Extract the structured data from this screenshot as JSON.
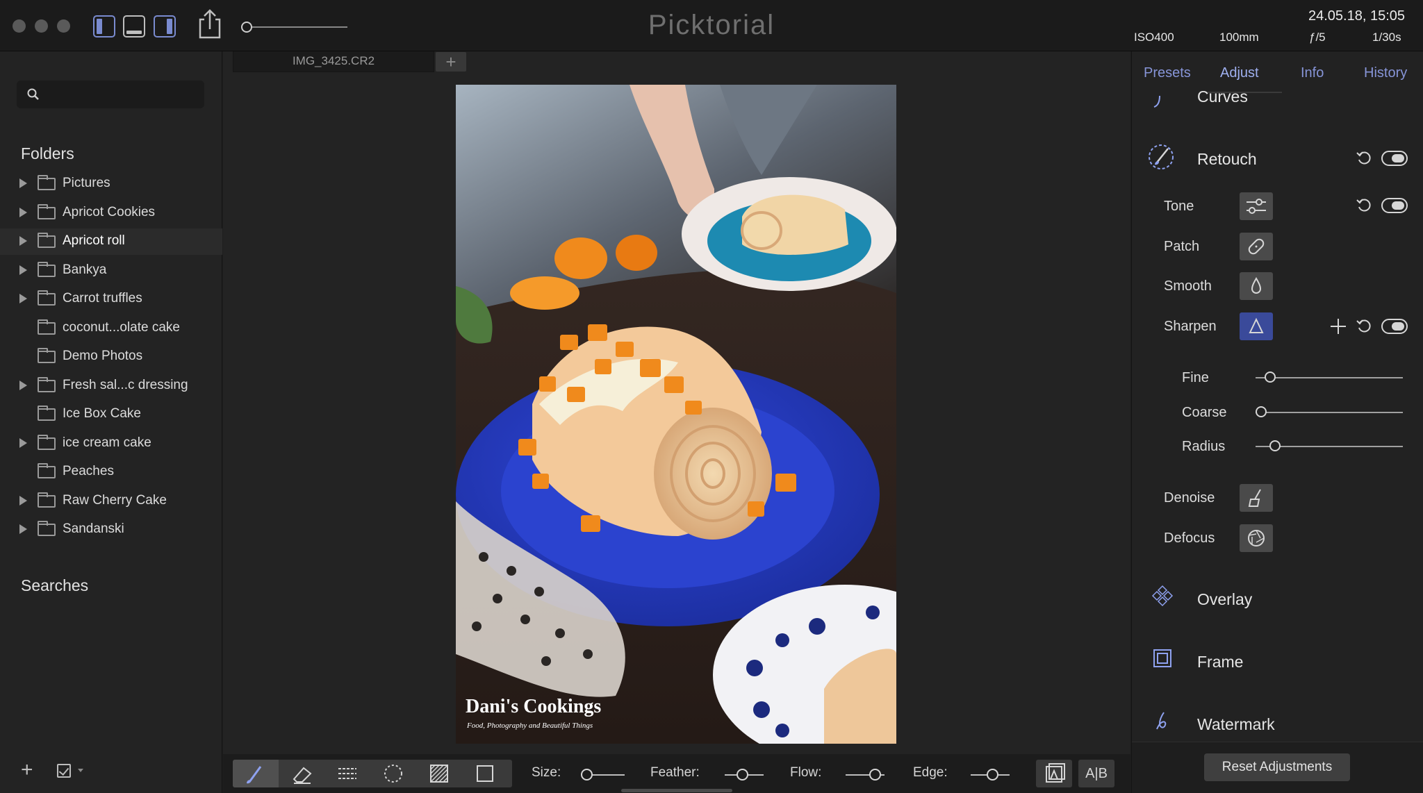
{
  "app": {
    "title": "Picktorial"
  },
  "exif": {
    "iso": "ISO400",
    "focal": "100mm",
    "aperture": "ƒ/5",
    "shutter": "1/30s",
    "datetime": "24.05.18, 15:05"
  },
  "tabs": {
    "open_file": "IMG_3425.CR2",
    "add": "+"
  },
  "sidebar": {
    "search_placeholder": "",
    "folders_title": "Folders",
    "searches_title": "Searches",
    "folders": [
      {
        "label": "Pictures",
        "expandable": true
      },
      {
        "label": "Apricot Cookies",
        "expandable": true
      },
      {
        "label": "Apricot roll",
        "expandable": true,
        "selected": true
      },
      {
        "label": "Bankya",
        "expandable": true
      },
      {
        "label": "Carrot truffles",
        "expandable": true
      },
      {
        "label": "coconut...olate cake",
        "expandable": false
      },
      {
        "label": "Demo Photos",
        "expandable": false
      },
      {
        "label": "Fresh sal...c dressing",
        "expandable": true
      },
      {
        "label": "Ice Box Cake",
        "expandable": false
      },
      {
        "label": "ice cream cake",
        "expandable": true
      },
      {
        "label": "Peaches",
        "expandable": false
      },
      {
        "label": "Raw Cherry Cake",
        "expandable": true
      },
      {
        "label": "Sandanski",
        "expandable": true
      }
    ],
    "add": "+"
  },
  "photo": {
    "watermark_title": "Dani's Cookings",
    "watermark_subtitle": "Food, Photography and Beautiful Things"
  },
  "bottom_bar": {
    "size_label": "Size:",
    "feather_label": "Feather:",
    "flow_label": "Flow:",
    "edge_label": "Edge:",
    "ab_label": "A|B"
  },
  "right_panel": {
    "tabs": [
      "Presets",
      "Adjust",
      "Info",
      "History"
    ],
    "active_tab": "Adjust",
    "curves": "Curves",
    "retouch": "Retouch",
    "tone": "Tone",
    "patch": "Patch",
    "smooth": "Smooth",
    "sharpen": "Sharpen",
    "fine": "Fine",
    "coarse": "Coarse",
    "radius": "Radius",
    "denoise": "Denoise",
    "defocus": "Defocus",
    "overlay": "Overlay",
    "frame": "Frame",
    "watermark": "Watermark",
    "reset": "Reset Adjustments",
    "sliders": {
      "fine": 0.1,
      "coarse": 0.04,
      "radius": 0.13
    }
  },
  "colors": {
    "accent": "#8795d8",
    "active_tool": "#3a4a9a",
    "plate": "#2438b8",
    "apricot": "#f08a1c"
  }
}
